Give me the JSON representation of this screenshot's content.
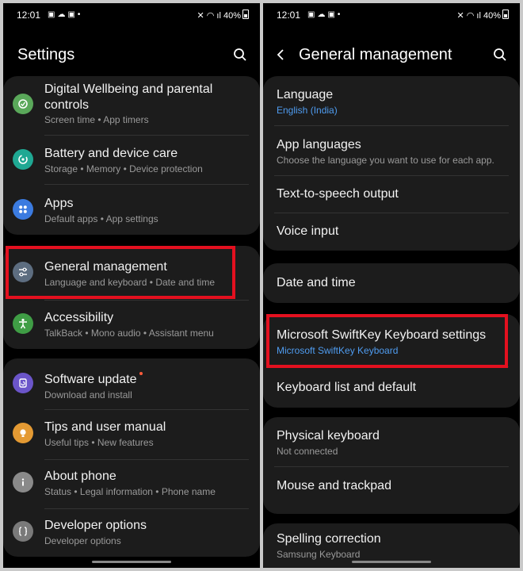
{
  "status": {
    "time": "12:01",
    "battery": "40%"
  },
  "left": {
    "title": "Settings",
    "items": [
      {
        "title": "Digital Wellbeing and parental",
        "title2": "controls",
        "subtitle": "Screen time  •  App timers",
        "icon": "wellbeing-icon",
        "color": "#5aa85a"
      },
      {
        "title": "Battery and device care",
        "subtitle": "Storage  •  Memory  •  Device protection",
        "icon": "device-care-icon",
        "color": "#1fa893"
      },
      {
        "title": "Apps",
        "subtitle": "Default apps  •  App settings",
        "icon": "apps-icon",
        "color": "#3b7be0"
      },
      {
        "title": "General management",
        "subtitle": "Language and keyboard  •  Date and time",
        "icon": "sliders-icon",
        "color": "#5d6d80"
      },
      {
        "title": "Accessibility",
        "subtitle": "TalkBack  •  Mono audio  •  Assistant menu",
        "icon": "accessibility-icon",
        "color": "#3f9d45"
      },
      {
        "title": "Software update",
        "subtitle": "Download and install",
        "icon": "software-update-icon",
        "color": "#6b55c9"
      },
      {
        "title": "Tips and user manual",
        "subtitle": "Useful tips  •  New features",
        "icon": "lightbulb-icon",
        "color": "#e49a33"
      },
      {
        "title": "About phone",
        "subtitle": "Status  •  Legal information  •  Phone name",
        "icon": "info-icon",
        "color": "#8a8a8a"
      },
      {
        "title": "Developer options",
        "subtitle": "Developer options",
        "icon": "braces-icon",
        "color": "#7a7a7a"
      }
    ]
  },
  "right": {
    "title": "General management",
    "items": [
      {
        "title": "Language",
        "subtitle": "English (India)",
        "subtitle_blue": true
      },
      {
        "title": "App languages",
        "subtitle": "Choose the language you want to use for each app."
      },
      {
        "title": "Text-to-speech output"
      },
      {
        "title": "Voice input"
      },
      {
        "title": "Date and time"
      },
      {
        "title": "Microsoft SwiftKey Keyboard settings",
        "subtitle": "Microsoft SwiftKey Keyboard",
        "subtitle_blue": true
      },
      {
        "title": "Keyboard list and default"
      },
      {
        "title": "Physical keyboard",
        "subtitle": "Not connected"
      },
      {
        "title": "Mouse and trackpad"
      },
      {
        "title": "Spelling correction",
        "subtitle": "Samsung Keyboard"
      }
    ]
  },
  "colors": {
    "highlight": "#e3101f",
    "accent_blue": "#4f9cf0",
    "card": "#1c1c1c"
  }
}
